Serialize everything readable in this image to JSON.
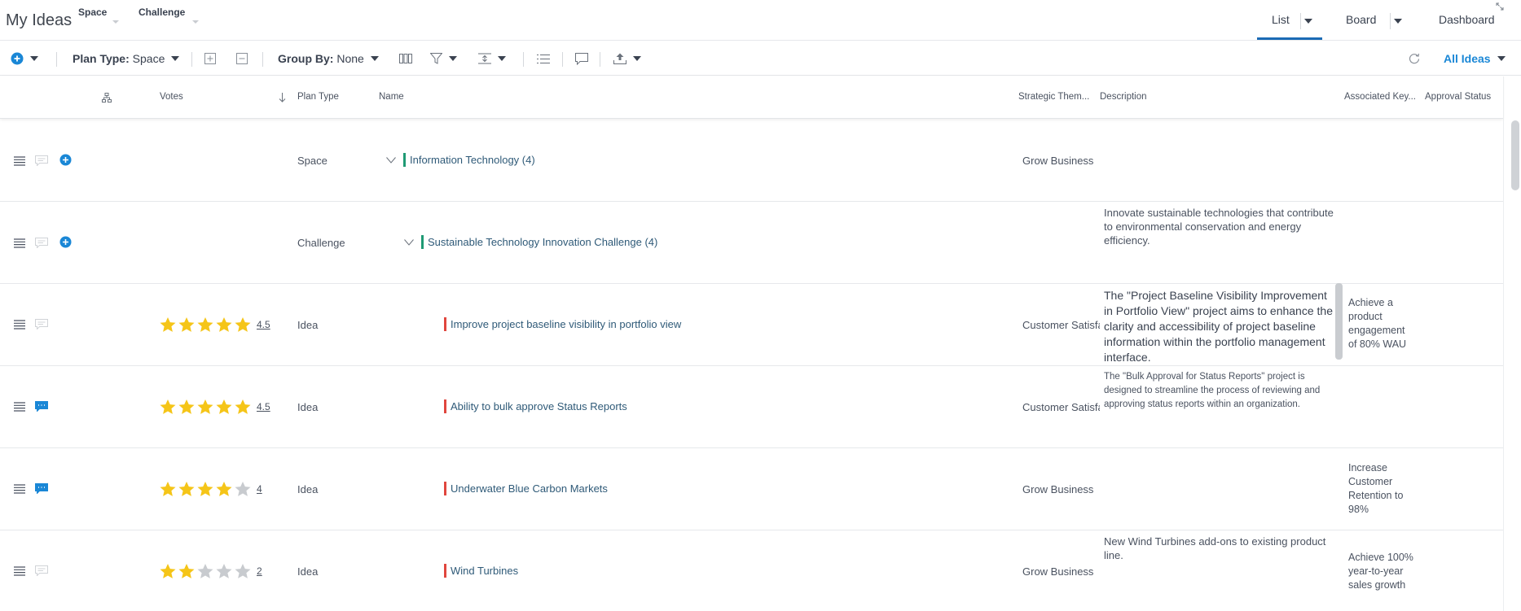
{
  "header": {
    "title": "My Ideas",
    "menus": [
      {
        "label": "Space"
      },
      {
        "label": "Challenge"
      }
    ],
    "views": {
      "list": "List",
      "board": "Board",
      "dashboard": "Dashboard"
    }
  },
  "toolbar": {
    "plan_type_label": "Plan Type:",
    "plan_type_value": "Space",
    "group_by_label": "Group By:",
    "group_by_value": "None",
    "filter_scope": "All Ideas"
  },
  "columns": {
    "votes": "Votes",
    "plan_type": "Plan Type",
    "name": "Name",
    "strategic_theme": "Strategic Them...",
    "description": "Description",
    "associated_key": "Associated Key...",
    "approval_status": "Approval Status"
  },
  "rows": [
    {
      "plan_type": "Space",
      "name": "Information Technology (4)",
      "strategic_theme": "Grow Business",
      "description": "",
      "associated_key": "",
      "bar_color": "#1f9a74"
    },
    {
      "plan_type": "Challenge",
      "name": "Sustainable Technology Innovation Challenge (4)",
      "strategic_theme": "",
      "description": "Innovate sustainable technologies that contribute to environmental conservation and energy efficiency.",
      "associated_key": "",
      "bar_color": "#1f9a74"
    },
    {
      "plan_type": "Idea",
      "rating": 4.5,
      "votes": "4.5",
      "name": "Improve project baseline visibility in portfolio view",
      "strategic_theme": "Customer Satisfaction",
      "description": "The \"Project Baseline Visibility Improvement in Portfolio View\" project aims to enhance the clarity and accessibility of project baseline information within the portfolio management interface.",
      "associated_key": "Achieve a product engagement of 80% WAU",
      "bar_color": "#e0463e"
    },
    {
      "plan_type": "Idea",
      "rating": 4.5,
      "votes": "4.5",
      "name": "Ability to bulk approve Status Reports",
      "strategic_theme": "Customer Satisfaction",
      "description": "The \"Bulk Approval for Status Reports\" project is designed to streamline the process of reviewing and approving status reports within an organization.",
      "associated_key": "",
      "bar_color": "#e0463e"
    },
    {
      "plan_type": "Idea",
      "rating": 4,
      "votes": "4",
      "name": "Underwater Blue Carbon Markets",
      "strategic_theme": "Grow Business",
      "description": "",
      "associated_key": "Increase Customer Retention to 98%",
      "bar_color": "#e0463e"
    },
    {
      "plan_type": "Idea",
      "rating": 2,
      "votes": "2",
      "name": "Wind Turbines",
      "strategic_theme": "Grow Business",
      "description": "New Wind Turbines add-ons to existing product line.",
      "associated_key": "Achieve 100% year-to-year sales growth",
      "bar_color": "#e0463e"
    }
  ],
  "colors": {
    "accent": "#1a87d6",
    "tab_underline": "#1b6bb5",
    "star_filled": "#f5c518",
    "star_empty": "#c8cbcf",
    "group_bar": "#1f9a74",
    "idea_bar": "#e0463e"
  }
}
